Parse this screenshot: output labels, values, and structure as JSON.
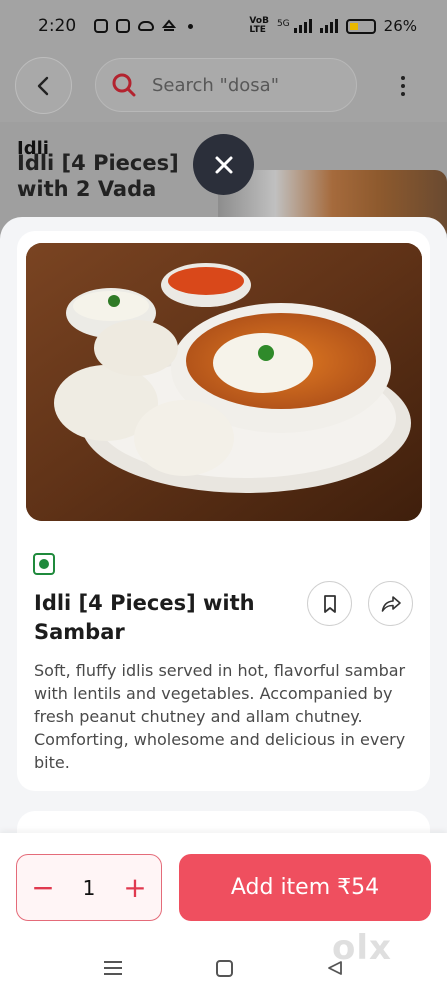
{
  "status_bar": {
    "time": "2:20",
    "network_label_top": "VoB",
    "network_label_bottom": "LTE",
    "network_type": "5G",
    "battery": "26%"
  },
  "header": {
    "search_placeholder": "Search \"dosa\""
  },
  "background": {
    "section_title": "Idli",
    "item_name_line1": "Idli [4 Pieces]",
    "item_name_line2": "with 2 Vada"
  },
  "item": {
    "title": "Idli [4 Pieces] with Sambar",
    "description": "Soft, fluffy idlis served in hot, flavorful sambar with lentils and vegetables. Accompanied by fresh peanut chutney and allam chutney. Comforting, wholesome and delicious in every bite.",
    "veg_indicator_color": "#1f8a3c"
  },
  "cart": {
    "quantity": "1",
    "decrement_symbol": "−",
    "increment_symbol": "+",
    "add_label": "Add item ₹54"
  },
  "colors": {
    "accent": "#ef4f5f",
    "close_button": "#2b2f3a"
  },
  "watermark": "olx"
}
